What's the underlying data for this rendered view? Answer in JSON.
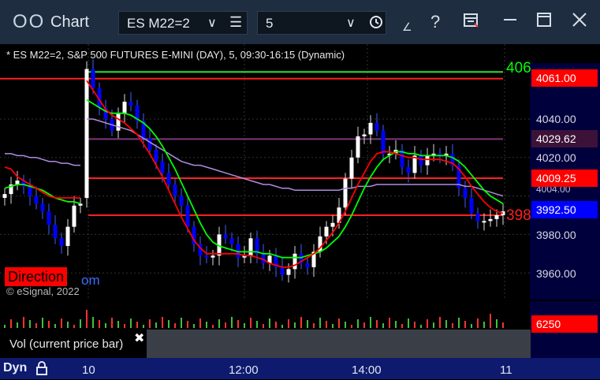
{
  "titlebar": {
    "app_icon": "OO",
    "title": "Chart",
    "symbol": "ES M22=2",
    "interval": "5",
    "help": "?"
  },
  "chart": {
    "header": "* ES M22=2, S&P 500 FUTURES E-MINI (DAY), 5, 09:30-16:15 (Dynamic)",
    "direction_label": "Direction",
    "link_fragment": "om",
    "copyright": "© eSignal, 2022",
    "cutoff_labels": [
      {
        "text": "406",
        "color": "#00ff00"
      },
      {
        "text": "398",
        "color": "#ff2020"
      }
    ],
    "price_labels": [
      "4040.00",
      "4020.00",
      "4004.00",
      "3980.00",
      "3960.00"
    ],
    "price_boxes": [
      {
        "text": "4061.00",
        "bg": "#ff0000",
        "fg": "#ffffff"
      },
      {
        "text": "4029.62",
        "bg": "#3d1238",
        "fg": "#ffffff"
      },
      {
        "text": "4009.25",
        "bg": "#ff0000",
        "fg": "#ffffff"
      },
      {
        "text": "3992.50",
        "bg": "#0000ff",
        "fg": "#ffffff"
      }
    ],
    "levels": [
      {
        "price": 4064.5,
        "color": "#32dc32"
      },
      {
        "price": 4061.0,
        "color": "#ff2020"
      },
      {
        "price": 4029.62,
        "color": "#7a3a7a"
      },
      {
        "price": 4009.25,
        "color": "#ff2020"
      },
      {
        "price": 3990.0,
        "color": "#ff2020"
      }
    ]
  },
  "volume": {
    "label": "Vol (current price bar)",
    "close": "✖",
    "value": "6250"
  },
  "timeline": {
    "mode": "Dyn",
    "labels": [
      "10",
      "12:00",
      "14:00",
      "11"
    ]
  },
  "chart_data": {
    "type": "candlestick",
    "symbol": "ES M22=2",
    "interval": "5",
    "session": "09:30-16:15",
    "y_ticks": [
      3960,
      3980,
      4020,
      4040
    ],
    "series_colors": {
      "up": "#ffffff",
      "down": "#0000ff",
      "ma_fast": "#ff0000",
      "ma_slow": "#00ff00",
      "ma_long": "#b08ce0"
    },
    "close": [
      4001,
      4006,
      4008,
      4005,
      4000,
      3996,
      3992,
      3985,
      3978,
      3974,
      3984,
      3995,
      3996,
      4066,
      4056,
      4046,
      4040,
      4034,
      4043,
      4049,
      4047,
      4039,
      4030,
      4024,
      4018,
      4012,
      4006,
      4000,
      3995,
      3984,
      3975,
      3969,
      3968,
      3969,
      3980,
      3978,
      3975,
      3968,
      3969,
      3978,
      3970,
      3965,
      3969,
      3963,
      3959,
      3962,
      3970,
      3965,
      3963,
      3971,
      3979,
      3984,
      3986,
      3994,
      4009,
      4020,
      4031,
      4032,
      4038,
      4034,
      4022,
      4022,
      4024,
      4015,
      4012,
      4021,
      4016,
      4021,
      4022,
      4021,
      4022,
      4016,
      4004,
      3999,
      3991,
      3987,
      3987,
      3988,
      3990,
      3992
    ],
    "ma_red": [
      4015,
      4014,
      4010,
      4008,
      4006,
      4004,
      4002,
      4000,
      3999,
      3999,
      3999,
      3999,
      3999,
      4060,
      4055,
      4050,
      4045,
      4042,
      4040,
      4038,
      4035,
      4032,
      4027,
      4022,
      4016,
      4010,
      4003,
      3996,
      3989,
      3983,
      3977,
      3973,
      3970,
      3970,
      3970,
      3970,
      3970,
      3970,
      3969,
      3969,
      3968,
      3967,
      3965,
      3964,
      3963,
      3963,
      3964,
      3966,
      3968,
      3970,
      3973,
      3977,
      3981,
      3986,
      3992,
      3999,
      4006,
      4012,
      4018,
      4022,
      4023,
      4023,
      4022,
      4021,
      4020,
      4020,
      4019,
      4019,
      4019,
      4019,
      4018,
      4017,
      4014,
      4010,
      4005,
      4001,
      3997,
      3994,
      3992,
      3991
    ],
    "ma_green": [
      4004,
      4005,
      4006,
      4006,
      4005,
      4004,
      4003,
      4001,
      3999,
      3998,
      3997,
      3997,
      3996,
      4050,
      4048,
      4046,
      4044,
      4043,
      4043,
      4043,
      4042,
      4040,
      4038,
      4035,
      4031,
      4026,
      4020,
      4014,
      4007,
      4000,
      3993,
      3986,
      3980,
      3976,
      3974,
      3973,
      3972,
      3971,
      3971,
      3971,
      3971,
      3970,
      3970,
      3969,
      3968,
      3968,
      3968,
      3968,
      3969,
      3970,
      3971,
      3973,
      3976,
      3979,
      3984,
      3990,
      3997,
      4004,
      4010,
      4015,
      4019,
      4021,
      4023,
      4023,
      4022,
      4022,
      4021,
      4021,
      4021,
      4021,
      4021,
      4020,
      4018,
      4015,
      4011,
      4007,
      4003,
      4000,
      3998,
      3996
    ],
    "ma_purple": [
      4022,
      4022,
      4021,
      4021,
      4020,
      4020,
      4019,
      4018,
      4018,
      4017,
      4017,
      4016,
      4016,
      4040,
      4040,
      4039,
      4038,
      4037,
      4036,
      4035,
      4034,
      4032,
      4030,
      4028,
      4026,
      4024,
      4022,
      4020,
      4018,
      4017,
      4016,
      4016,
      4015,
      4014,
      4013,
      4012,
      4011,
      4010,
      4009,
      4008,
      4007,
      4006,
      4006,
      4005,
      4004,
      4004,
      4003,
      4003,
      4003,
      4003,
      4003,
      4003,
      4003,
      4003,
      4004,
      4004,
      4005,
      4005,
      4005,
      4006,
      4006,
      4006,
      4006,
      4006,
      4006,
      4006,
      4006,
      4006,
      4006,
      4006,
      4006,
      4006,
      4006,
      4005,
      4005,
      4004,
      4003,
      4002,
      4001,
      4000
    ]
  }
}
